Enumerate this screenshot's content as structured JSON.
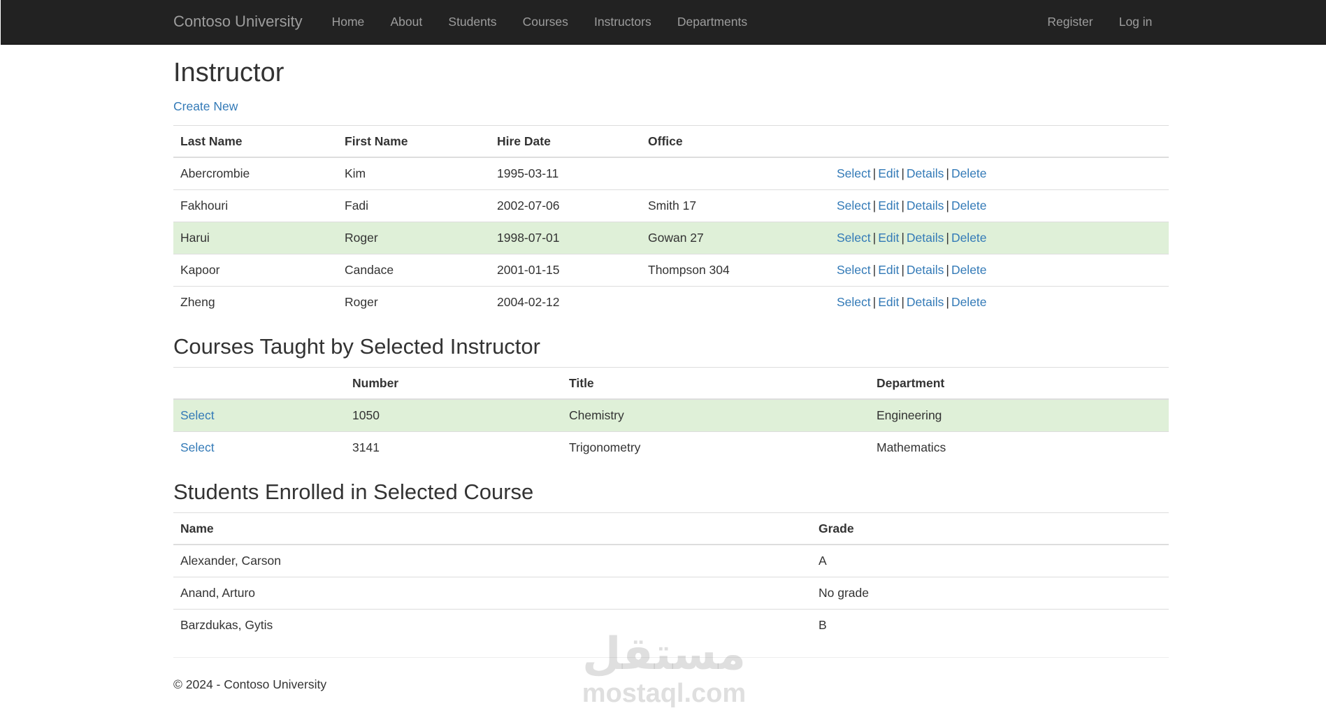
{
  "navbar": {
    "brand": "Contoso University",
    "links": [
      "Home",
      "About",
      "Students",
      "Courses",
      "Instructors",
      "Departments"
    ],
    "right_links": [
      "Register",
      "Log in"
    ]
  },
  "page": {
    "title": "Instructor",
    "create_new": "Create New"
  },
  "instructors": {
    "headers": [
      "Last Name",
      "First Name",
      "Hire Date",
      "Office"
    ],
    "action_labels": [
      "Select",
      "Edit",
      "Details",
      "Delete"
    ],
    "rows": [
      {
        "last": "Abercrombie",
        "first": "Kim",
        "hire": "1995-03-11",
        "office": "",
        "selected": false
      },
      {
        "last": "Fakhouri",
        "first": "Fadi",
        "hire": "2002-07-06",
        "office": "Smith 17",
        "selected": false
      },
      {
        "last": "Harui",
        "first": "Roger",
        "hire": "1998-07-01",
        "office": "Gowan 27",
        "selected": true
      },
      {
        "last": "Kapoor",
        "first": "Candace",
        "hire": "2001-01-15",
        "office": "Thompson 304",
        "selected": false
      },
      {
        "last": "Zheng",
        "first": "Roger",
        "hire": "2004-02-12",
        "office": "",
        "selected": false
      }
    ]
  },
  "courses": {
    "title": "Courses Taught by Selected Instructor",
    "headers": [
      "",
      "Number",
      "Title",
      "Department"
    ],
    "select_label": "Select",
    "rows": [
      {
        "number": "1050",
        "title": "Chemistry",
        "department": "Engineering",
        "selected": true
      },
      {
        "number": "3141",
        "title": "Trigonometry",
        "department": "Mathematics",
        "selected": false
      }
    ]
  },
  "enrollments": {
    "title": "Students Enrolled in Selected Course",
    "headers": [
      "Name",
      "Grade"
    ],
    "rows": [
      {
        "name": "Alexander, Carson",
        "grade": "A"
      },
      {
        "name": "Anand, Arturo",
        "grade": "No grade"
      },
      {
        "name": "Barzdukas, Gytis",
        "grade": "B"
      }
    ]
  },
  "footer": {
    "text": "© 2024 - Contoso University"
  },
  "watermark": {
    "arabic": "مستقل",
    "latin": "mostaql.com"
  },
  "colors": {
    "navbar_bg": "#222222",
    "nav_text": "#9d9d9d",
    "link": "#337ab7",
    "selected_row": "#dff0d8"
  }
}
